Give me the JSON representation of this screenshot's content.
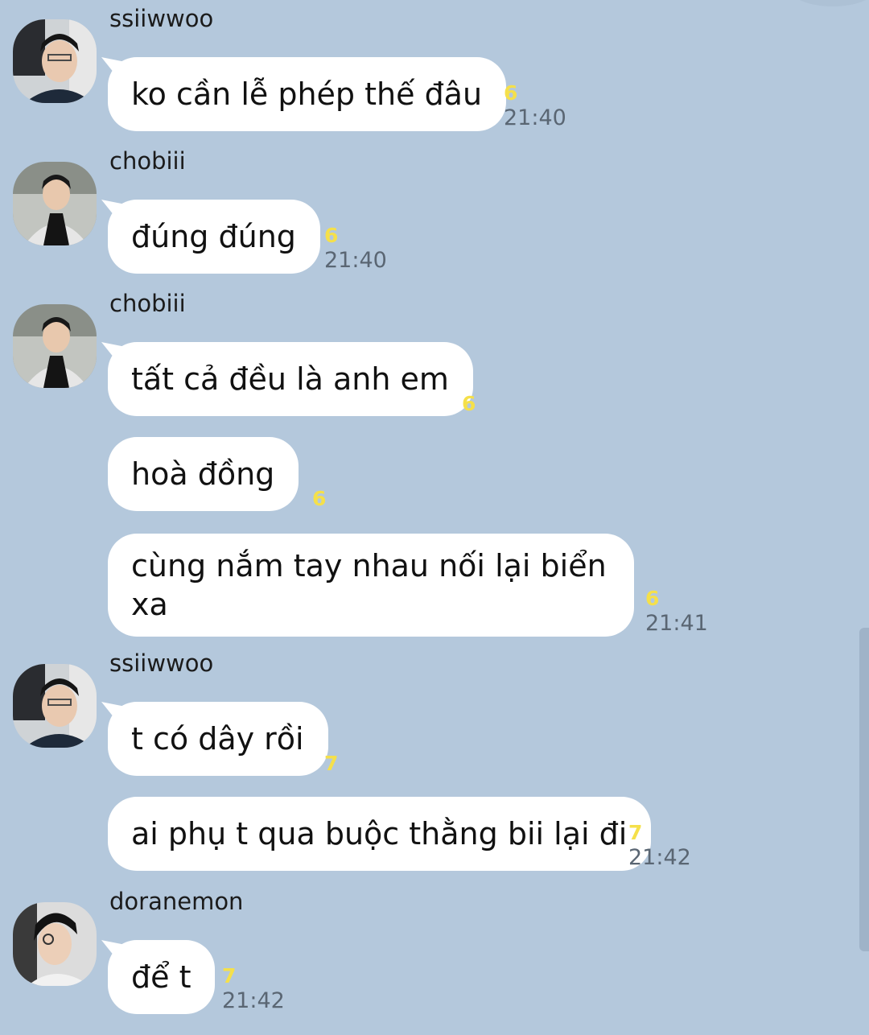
{
  "messages": [
    {
      "sender": "ssiiwwoo",
      "text": "ko cần lễ phép thế đâu",
      "unread": "6",
      "time": "21:40"
    },
    {
      "sender": "chobiii",
      "text": "đúng đúng",
      "unread": "6",
      "time": "21:40"
    },
    {
      "sender": "chobiii",
      "text": "tất cả đều là anh em",
      "unread": "6",
      "time": ""
    },
    {
      "sender": "",
      "text": "hoà đồng",
      "unread": "6",
      "time": ""
    },
    {
      "sender": "",
      "text": "cùng nắm tay nhau nối lại biển xa",
      "unread": "6",
      "time": "21:41"
    },
    {
      "sender": "ssiiwwoo",
      "text": "t có dây rồi",
      "unread": "7",
      "time": ""
    },
    {
      "sender": "",
      "text": "ai phụ t qua buộc thằng bii lại đi",
      "unread": "7",
      "time": "21:42"
    },
    {
      "sender": "doranemon",
      "text": "để t",
      "unread": "7",
      "time": "21:42"
    }
  ],
  "colors": {
    "background": "#b4c8dc",
    "bubble": "#ffffff",
    "unread": "#f5e04a",
    "time": "#5a6673"
  }
}
